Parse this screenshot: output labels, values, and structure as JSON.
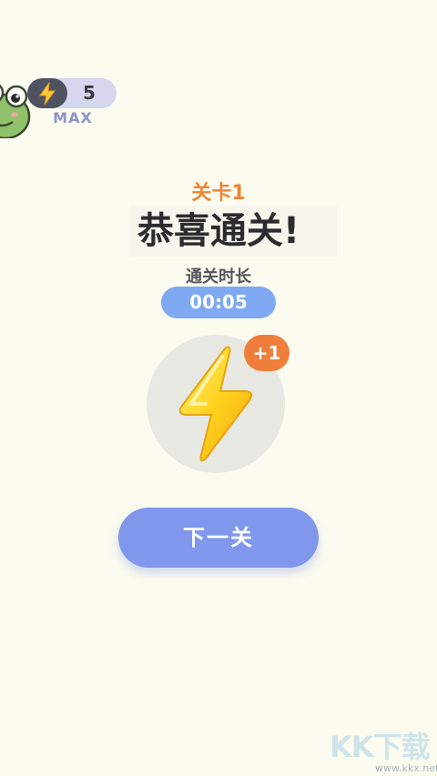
{
  "hud": {
    "energy_count": "5",
    "energy_status": "MAX",
    "energy_icon": "lightning-bolt-icon",
    "mascot_icon": "frog-icon"
  },
  "result": {
    "level_label": "关卡1",
    "title": "恭喜通关!",
    "time_label": "通关时长",
    "time_value": "00:05"
  },
  "reward": {
    "icon": "lightning-bolt-icon",
    "badge": "+1"
  },
  "actions": {
    "next_label": "下一关"
  },
  "watermark": {
    "logo": "KK下载",
    "url": "www.kkx.net"
  },
  "colors": {
    "background": "#fbfbef",
    "accent_orange": "#ef8434",
    "time_pill": "#7fa9f2",
    "button": "#8097ec",
    "energy_pill": "#d6d7ee"
  }
}
